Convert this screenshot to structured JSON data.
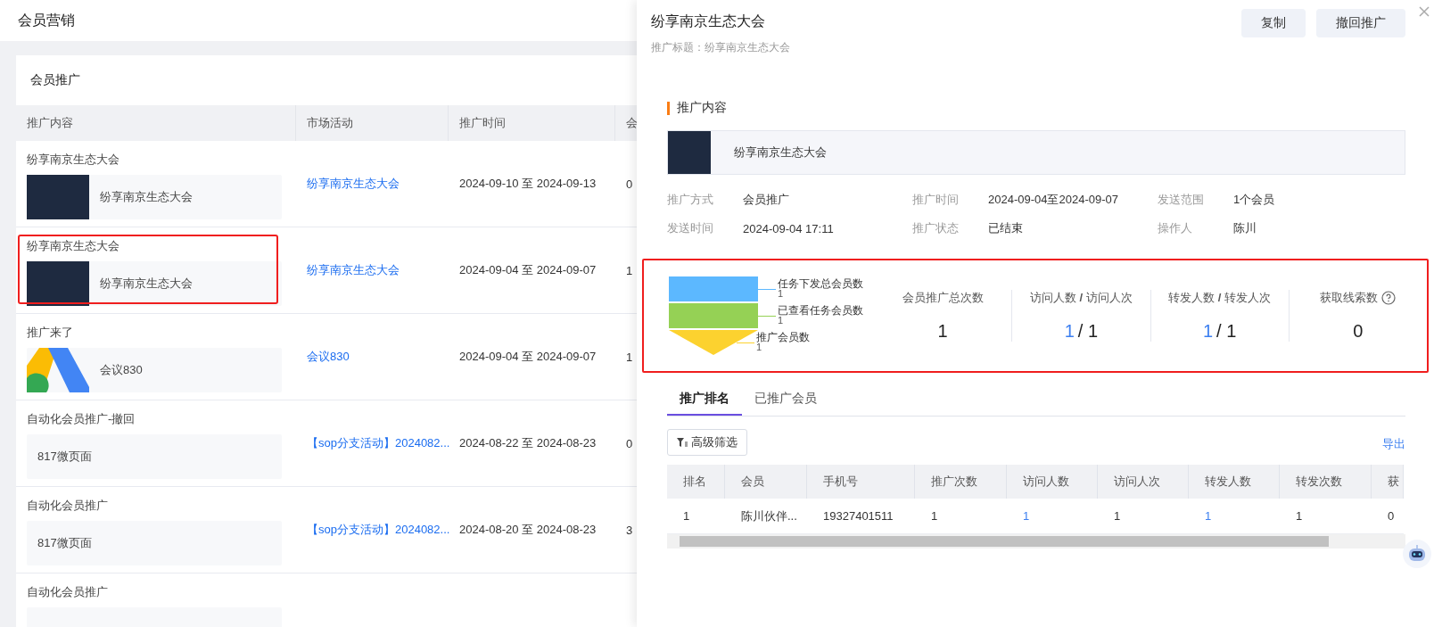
{
  "page": {
    "title": "会员营销"
  },
  "card": {
    "title": "会员推广"
  },
  "table": {
    "columns": [
      "推广内容",
      "市场活动",
      "推广时间",
      "会"
    ],
    "rows": [
      {
        "title": "纷享南京生态大会",
        "content": {
          "kind": "photo",
          "name": "纷享南京生态大会"
        },
        "activity": "纷享南京生态大会",
        "period": "2024-09-10 至 2024-09-13",
        "column_4": "0",
        "highlighted": false
      },
      {
        "title": "纷享南京生态大会",
        "content": {
          "kind": "photo",
          "name": "纷享南京生态大会"
        },
        "activity": "纷享南京生态大会",
        "period": "2024-09-04 至 2024-09-07",
        "column_4": "1",
        "highlighted": true
      },
      {
        "title": "推广来了",
        "content": {
          "kind": "logo",
          "name": "会议830"
        },
        "activity": "会议830",
        "period": "2024-09-04 至 2024-09-07",
        "column_4": "1",
        "highlighted": false
      },
      {
        "title": "自动化会员推广-撤回",
        "content": {
          "kind": "text",
          "name": "817微页面"
        },
        "activity": "【sop分支活动】2024082...",
        "period": "2024-08-22 至 2024-08-23",
        "column_4": "0",
        "highlighted": false
      },
      {
        "title": "自动化会员推广",
        "content": {
          "kind": "text",
          "name": "817微页面"
        },
        "activity": "【sop分支活动】2024082...",
        "period": "2024-08-20 至 2024-08-23",
        "column_4": "3",
        "highlighted": false
      },
      {
        "title": "自动化会员推广",
        "content": {
          "kind": "text"
        },
        "highlighted": false
      }
    ]
  },
  "drawer": {
    "title": "纷享南京生态大会",
    "subtitle": "推广标题：纷享南京生态大会",
    "buttons": [
      "复制",
      "撤回推广"
    ],
    "section_title": "推广内容",
    "content": {
      "name": "纷享南京生态大会"
    },
    "info": [
      {
        "label": "推广方式",
        "value": "会员推广"
      },
      {
        "label": "推广时间",
        "value": "2024-09-04至2024-09-07"
      },
      {
        "label": "发送范围",
        "value": "1个会员"
      },
      {
        "label": "发送时间",
        "value": "2024-09-04 17:11"
      },
      {
        "label": "推广状态",
        "value": "已结束"
      },
      {
        "label": "操作人",
        "value": "陈川"
      }
    ],
    "stats": {
      "highlighted": true,
      "funnel": [
        {
          "label": "任务下发总会员数",
          "value": "1",
          "color": "#5cb8ff"
        },
        {
          "label": "已查看任务会员数",
          "value": "1",
          "color": "#95d155"
        },
        {
          "label": "推广会员数",
          "value": "1",
          "color": "#fcd22f"
        }
      ],
      "metrics": [
        {
          "kind": "single",
          "label": "会员推广总次数",
          "value": "1",
          "help": false
        },
        {
          "kind": "pair",
          "label": "访问人数 **/** 访问人次",
          "first": "1",
          "second": "/ 1",
          "help": false
        },
        {
          "kind": "pair",
          "label": "转发人数 **/** 转发人次",
          "first": "1",
          "second": "/ 1",
          "help": false
        },
        {
          "kind": "single",
          "label": "获取线索数",
          "value": "0",
          "help": true
        }
      ]
    },
    "tabs": [
      {
        "label": "推广排名",
        "selected": true
      },
      {
        "label": "已推广会员",
        "selected": false
      }
    ],
    "filter_button": "高级筛选",
    "export_link": "导出",
    "ranking": {
      "columns": [
        "排名",
        "会员",
        "手机号",
        "推广次数",
        "访问人数",
        "访问人次",
        "转发人数",
        "转发次数",
        "获"
      ],
      "rows": [
        {
          "cells": [
            {
              "text": "1",
              "link": false
            },
            {
              "text": "陈川伙伴...",
              "link": false
            },
            {
              "text": "19327401511",
              "link": false
            },
            {
              "text": "1",
              "link": false
            },
            {
              "text": "1",
              "link": true
            },
            {
              "text": "1",
              "link": false
            },
            {
              "text": "1",
              "link": true
            },
            {
              "text": "1",
              "link": false
            },
            {
              "text": "0",
              "link": false
            }
          ]
        }
      ]
    }
  }
}
